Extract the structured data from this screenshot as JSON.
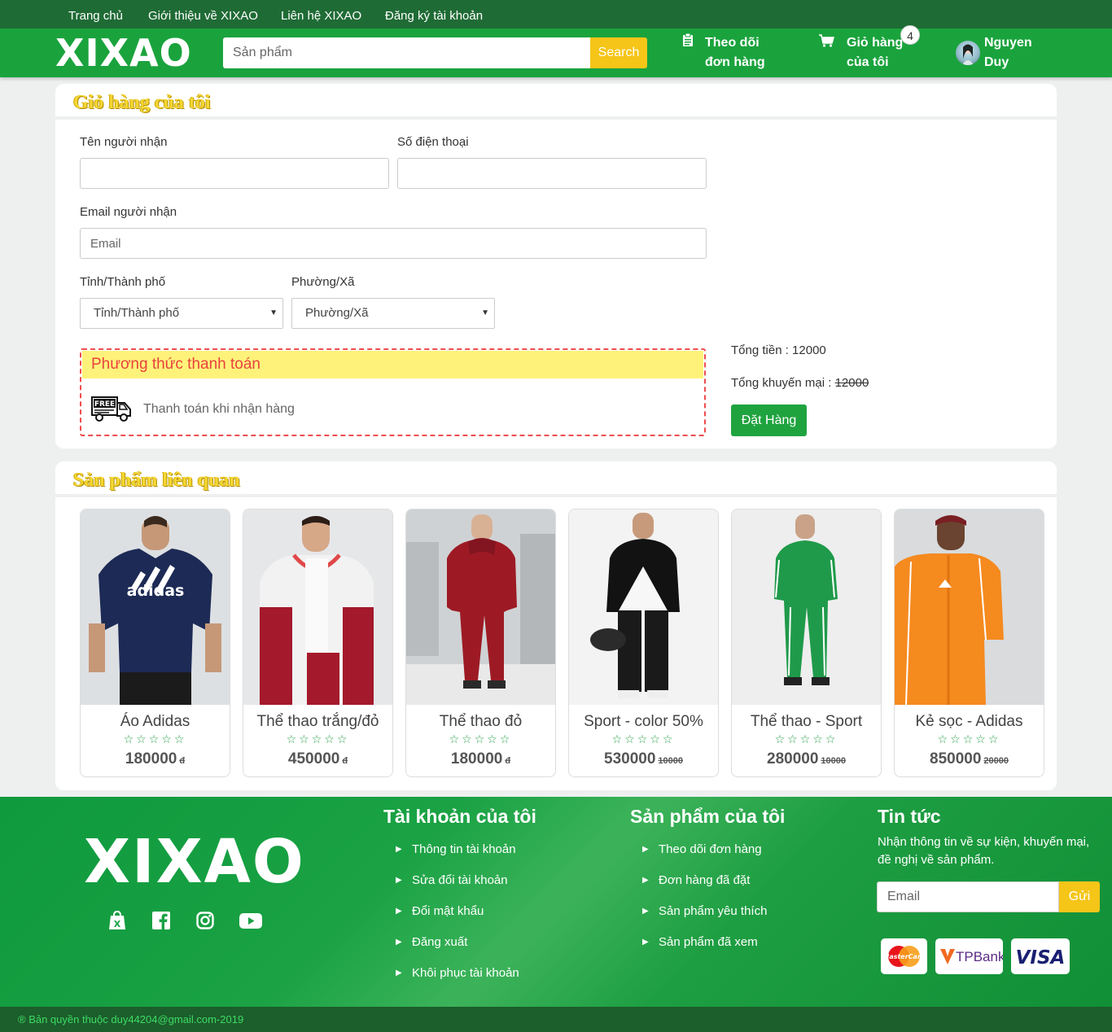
{
  "topnav": [
    "Trang chủ",
    "Giới thiệu về XIXAO",
    "Liên hệ XIXAO",
    "Đăng ký tài khoản"
  ],
  "header": {
    "logo": "XIXAO",
    "search_placeholder": "Sản phẩm",
    "search_button": "Search",
    "track_line1": "Theo dõi",
    "track_line2": "đơn hàng",
    "cart_line1": "Giỏ hàng",
    "cart_line2": "của tôi",
    "cart_count": "4",
    "user_line1": "Nguyen",
    "user_line2": "Duy"
  },
  "cart": {
    "title": "Giỏ hàng của tôi",
    "name_label": "Tên người nhận",
    "phone_label": "Số điện thoại",
    "email_label": "Email người nhận",
    "email_placeholder": "Email",
    "city_label": "Tỉnh/Thành phố",
    "city_selected": "Tỉnh/Thành phố",
    "ward_label": "Phường/Xã",
    "ward_selected": "Phường/Xã",
    "payment_title": "Phương thức thanh toán",
    "payment_option": "Thanh toán khi nhận hàng",
    "free_label": "FREE",
    "total_label": "Tổng tiền : 12000",
    "discount_label": "Tổng khuyến mại : ",
    "discount_value": "12000",
    "order_button": "Đặt Hàng"
  },
  "related": {
    "title": "Sản phẩm liên quan",
    "stars": "☆☆☆☆☆",
    "products": [
      {
        "name": "Áo Adidas",
        "price": "180000",
        "old": "đ"
      },
      {
        "name": "Thể thao trắng/đỏ",
        "price": "450000",
        "old": "đ"
      },
      {
        "name": "Thể thao đỏ",
        "price": "180000",
        "old": "đ"
      },
      {
        "name": "Sport - color 50%",
        "price": "530000",
        "old": "10000"
      },
      {
        "name": "Thể thao - Sport",
        "price": "280000",
        "old": "10000"
      },
      {
        "name": "Kẻ sọc - Adidas",
        "price": "850000",
        "old": "20000"
      }
    ]
  },
  "footer": {
    "logo": "XIXAO",
    "account_title": "Tài khoản của tôi",
    "account_links": [
      "Thông tin tài khoản",
      "Sửa đổi tài khoản",
      "Đổi mật khẩu",
      "Đăng xuất",
      "Khôi phục tài khoản"
    ],
    "products_title": "Sản phẩm của tôi",
    "product_links": [
      "Theo dõi đơn hàng",
      "Đơn hàng đã đặt",
      "Sản phẩm yêu thích",
      "Sản phẩm đã xem"
    ],
    "news_title": "Tin tức",
    "news_text": "Nhận thông tin về sự kiện, khuyến mại, đề nghị về sản phẩm.",
    "email_placeholder": "Email",
    "send_button": "Gửi",
    "payment_logos": [
      "MasterCard",
      "TPBank",
      "VISA"
    ],
    "copyright": "® Bản quyền thuộc duy44204@gmail.com-2019"
  },
  "colors": {
    "primary_green": "#1aa33d",
    "dark_green": "#1f6b35",
    "yellow": "#f5c518",
    "title_yellow": "#f5d733",
    "red_dashed": "#ef4d4d"
  }
}
